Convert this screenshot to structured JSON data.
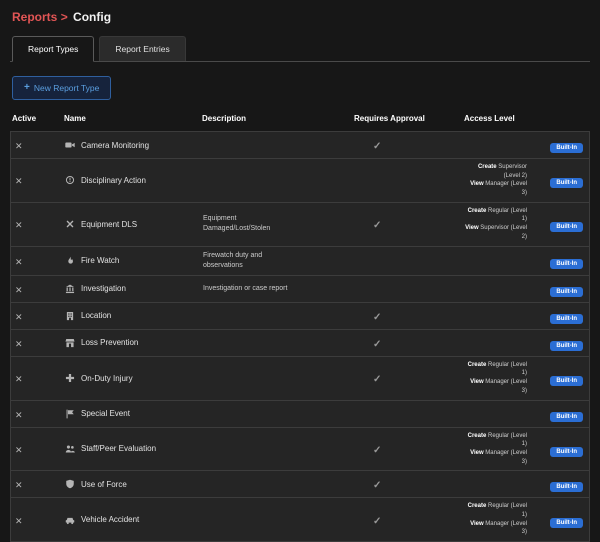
{
  "breadcrumb": {
    "section": "Reports",
    "separator": ">",
    "page": "Config"
  },
  "tabs": {
    "report_types": "Report Types",
    "report_entries": "Report Entries"
  },
  "toolbar": {
    "plus": "+",
    "new_report_type_label": "New Report Type"
  },
  "table": {
    "columns": {
      "active": "Active",
      "name": "Name",
      "description": "Description",
      "requires_approval": "Requires Approval",
      "access_level": "Access Level"
    },
    "active_symbol": "✕",
    "approval_symbol": "✓",
    "rows": [
      {
        "icon": "camera-icon",
        "name": "Camera Monitoring",
        "description": "",
        "requires_approval": true,
        "access": [],
        "badge": "Built-In"
      },
      {
        "icon": "exclamation-circle-icon",
        "name": "Disciplinary Action",
        "description": "",
        "requires_approval": false,
        "access": [
          {
            "action": "Create",
            "detail": "Supervisor (Level 2)"
          },
          {
            "action": "View",
            "detail": "Manager (Level 3)"
          }
        ],
        "badge": "Built-In"
      },
      {
        "icon": "tools-icon",
        "name": "Equipment DLS",
        "description": "Equipment Damaged/Lost/Stolen",
        "requires_approval": true,
        "access": [
          {
            "action": "Create",
            "detail": "Regular (Level 1)"
          },
          {
            "action": "View",
            "detail": "Supervisor (Level 2)"
          }
        ],
        "badge": "Built-In"
      },
      {
        "icon": "fire-icon",
        "name": "Fire Watch",
        "description": "Firewatch duty and observations",
        "requires_approval": false,
        "access": [],
        "badge": "Built-In"
      },
      {
        "icon": "bank-icon",
        "name": "Investigation",
        "description": "Investigation or case report",
        "requires_approval": false,
        "access": [],
        "badge": "Built-In"
      },
      {
        "icon": "building-icon",
        "name": "Location",
        "description": "",
        "requires_approval": true,
        "access": [],
        "badge": "Built-In"
      },
      {
        "icon": "store-icon",
        "name": "Loss Prevention",
        "description": "",
        "requires_approval": true,
        "access": [],
        "badge": "Built-In"
      },
      {
        "icon": "medical-cross-icon",
        "name": "On-Duty Injury",
        "description": "",
        "requires_approval": true,
        "access": [
          {
            "action": "Create",
            "detail": "Regular (Level 1)"
          },
          {
            "action": "View",
            "detail": "Manager (Level 3)"
          }
        ],
        "badge": "Built-In"
      },
      {
        "icon": "flag-icon",
        "name": "Special Event",
        "description": "",
        "requires_approval": false,
        "access": [],
        "badge": "Built-In"
      },
      {
        "icon": "people-icon",
        "name": "Staff/Peer Evaluation",
        "description": "",
        "requires_approval": true,
        "access": [
          {
            "action": "Create",
            "detail": "Regular (Level 1)"
          },
          {
            "action": "View",
            "detail": "Manager (Level 3)"
          }
        ],
        "badge": "Built-In"
      },
      {
        "icon": "shield-icon",
        "name": "Use of Force",
        "description": "",
        "requires_approval": true,
        "access": [],
        "badge": "Built-In"
      },
      {
        "icon": "car-icon",
        "name": "Vehicle Accident",
        "description": "",
        "requires_approval": true,
        "access": [
          {
            "action": "Create",
            "detail": "Regular (Level 1)"
          },
          {
            "action": "View",
            "detail": "Manager (Level 3)"
          }
        ],
        "badge": "Built-In"
      }
    ]
  },
  "colors": {
    "breadcrumb_red": "#e25555",
    "button_blue": "#5b9fe0",
    "badge_blue": "#2b6ed4"
  }
}
